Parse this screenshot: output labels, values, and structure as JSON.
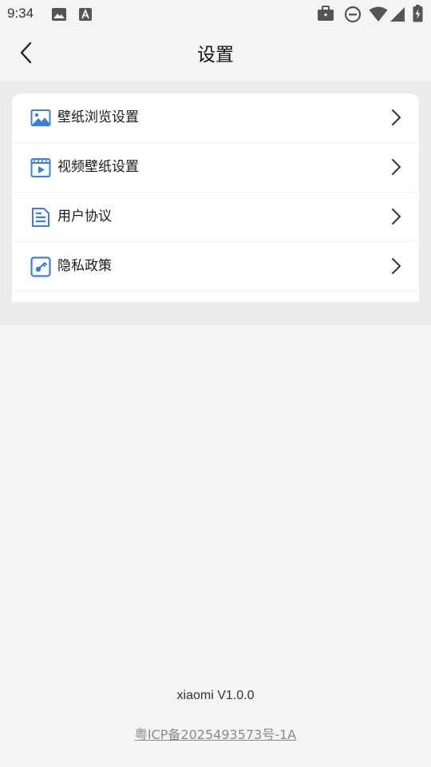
{
  "status_bar": {
    "time": "9:34",
    "left_icons": [
      "image-icon",
      "font-icon"
    ],
    "right_icons": [
      "briefcase-icon",
      "do-not-disturb-icon",
      "wifi-icon",
      "signal-icon",
      "battery-charging-icon"
    ]
  },
  "app_bar": {
    "title": "设置",
    "back_icon": "chevron-left-icon"
  },
  "settings": {
    "items": [
      {
        "label": "壁纸浏览设置",
        "icon": "image-icon"
      },
      {
        "label": "视频壁纸设置",
        "icon": "video-icon"
      },
      {
        "label": "用户协议",
        "icon": "document-icon"
      },
      {
        "label": "隐私政策",
        "icon": "key-icon"
      }
    ]
  },
  "footer": {
    "version": "xiaomi V1.0.0",
    "icp": "粤ICP备2025493573号-1A"
  },
  "colors": {
    "accent": "#3a7ee0",
    "background": "#f4f4f4",
    "card": "#ffffff"
  }
}
